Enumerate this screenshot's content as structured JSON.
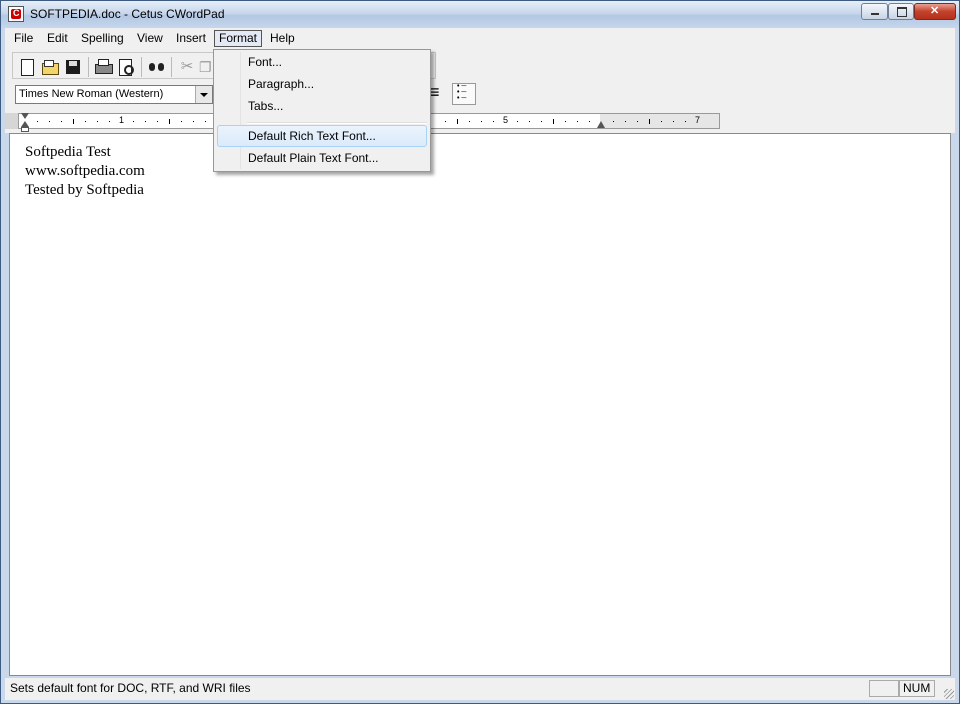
{
  "window": {
    "title": "SOFTPEDIA.doc - Cetus CWordPad"
  },
  "menubar": {
    "items": [
      {
        "label": "File"
      },
      {
        "label": "Edit"
      },
      {
        "label": "Spelling"
      },
      {
        "label": "View"
      },
      {
        "label": "Insert"
      },
      {
        "label": "Format"
      },
      {
        "label": "Help"
      }
    ],
    "active": "Format"
  },
  "toolbar": {
    "icons": [
      "new-document-icon",
      "open-folder-icon",
      "save-disk-icon",
      "print-icon",
      "print-preview-icon",
      "find-binoculars-icon",
      "cut-icon",
      "copy-icon"
    ],
    "font_combo_value": "Times New Roman (Western)"
  },
  "ruler": {
    "labels": [
      "1",
      "5",
      "7"
    ]
  },
  "format_menu": {
    "items": [
      {
        "label": "Font..."
      },
      {
        "label": "Paragraph..."
      },
      {
        "label": "Tabs..."
      },
      {
        "label": "Default Rich Text Font..."
      },
      {
        "label": "Default Plain Text Font..."
      }
    ],
    "highlighted": "Default Rich Text Font..."
  },
  "document": {
    "lines": [
      "Softpedia Test",
      "www.softpedia.com",
      "Tested by Softpedia"
    ]
  },
  "statusbar": {
    "message": "Sets default font for DOC, RTF, and WRI files",
    "num_indicator": "NUM"
  }
}
